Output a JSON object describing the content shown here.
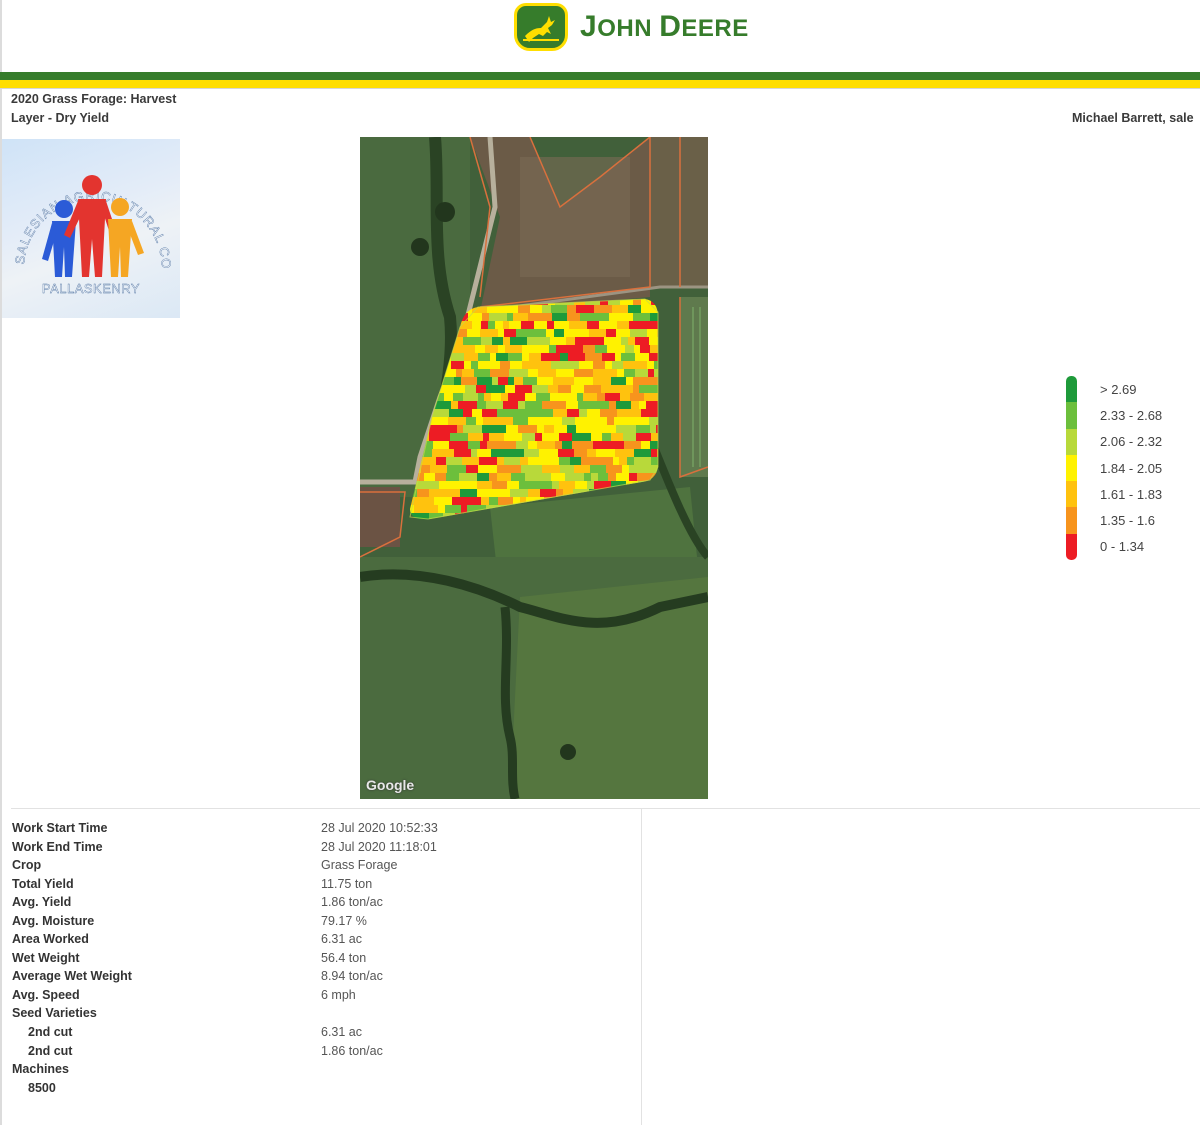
{
  "brand": {
    "name": "John Deere",
    "name_first": "J",
    "name_rest1": "OHN ",
    "name_second": "D",
    "name_rest2": "EERE"
  },
  "colors": {
    "jd_green": "#367c2b",
    "jd_yellow": "#ffde00"
  },
  "report": {
    "title": "2020 Grass Forage: Harvest",
    "layer": "Layer - Dry Yield",
    "user": "Michael Barrett, sale"
  },
  "college_logo": {
    "icon": "salesian-college-logo-icon",
    "arc_text": "SALESIAN AGRICULTURAL COLLEGE",
    "bottom_text": "PALLASKENRY"
  },
  "map": {
    "attribution": "Google",
    "icon": "satellite-yield-map"
  },
  "legend": [
    {
      "label": "> 2.69",
      "color": "#1e9a3a"
    },
    {
      "label": "2.33 - 2.68",
      "color": "#6cbf3c"
    },
    {
      "label": "2.06 - 2.32",
      "color": "#b8d93a"
    },
    {
      "label": "1.84 - 2.05",
      "color": "#fff200"
    },
    {
      "label": "1.61 - 1.83",
      "color": "#ffc20e"
    },
    {
      "label": "1.35 - 1.6",
      "color": "#f7941d"
    },
    {
      "label": "0 - 1.34",
      "color": "#ed1c24"
    }
  ],
  "details": [
    {
      "label": "Work Start Time",
      "value": "28 Jul 2020 10:52:33"
    },
    {
      "label": "Work End Time",
      "value": "28 Jul 2020 11:18:01"
    },
    {
      "label": "Crop",
      "value": "Grass Forage"
    },
    {
      "label": "Total Yield",
      "value": "11.75 ton"
    },
    {
      "label": "Avg. Yield",
      "value": "1.86 ton/ac"
    },
    {
      "label": "Avg. Moisture",
      "value": "79.17 %"
    },
    {
      "label": "Area Worked",
      "value": "6.31 ac"
    },
    {
      "label": "Wet Weight",
      "value": "56.4 ton"
    },
    {
      "label": "Average Wet Weight",
      "value": "8.94 ton/ac"
    },
    {
      "label": "Avg. Speed",
      "value": "6 mph"
    },
    {
      "label": "Seed Varieties",
      "value": ""
    },
    {
      "label": "2nd cut",
      "value": "6.31 ac",
      "indent": true
    },
    {
      "label": "2nd cut",
      "value": "1.86 ton/ac",
      "indent": true
    },
    {
      "label": "Machines",
      "value": ""
    },
    {
      "label": "8500",
      "value": "",
      "indent": true
    }
  ]
}
